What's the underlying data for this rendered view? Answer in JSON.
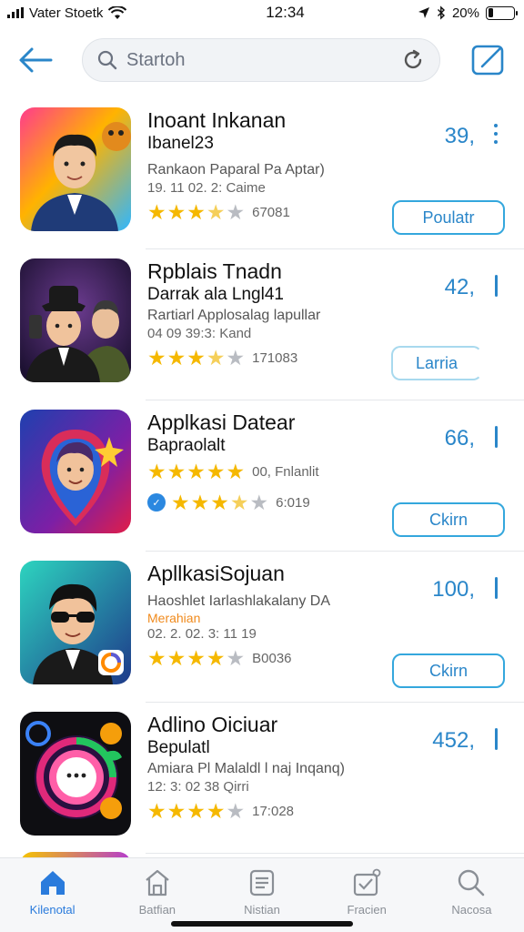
{
  "status_bar": {
    "carrier": "Vater Stoetk",
    "time": "12:34",
    "battery": "20%",
    "battery_fraction": 0.2
  },
  "header": {
    "search_placeholder": "Startoh",
    "back_icon": "arrow-left-icon",
    "refresh_icon": "refresh-icon",
    "compose_icon": "compose-icon"
  },
  "apps": [
    {
      "title": "Inoant Inkanan",
      "subtitle": "Ibanel23",
      "description": "Rankaon Paparal Pa Aptar)",
      "meta": "19. 11 02. 2: Caime",
      "rating": 3.5,
      "rating_count": "67081",
      "price": "39,",
      "action": "Poulatr"
    },
    {
      "title": "Rpblais Tnadn",
      "subtitle": "Darrak ala Lngl41",
      "description": "Rartiarl Applosalag lapullar",
      "meta": "04 09 39:3: Kand",
      "rating": 3.5,
      "rating_count": "171083",
      "price": "42,",
      "action": "Larria"
    },
    {
      "title": "Applkasi Datear",
      "subtitle": "Bapraolalt",
      "description": "",
      "meta": "",
      "rating": 5,
      "rating_text": "00, Fnlanlit",
      "rating2": 3.5,
      "rating_count": "6:019",
      "price": "66,",
      "action": "Ckirn"
    },
    {
      "title": "ApllkasiSojuan",
      "subtitle": "",
      "description": "Haoshlet Iarlashlakalany DA",
      "tag": "Merahian",
      "meta": "02. 2. 02. 3: 11 19",
      "rating": 4,
      "rating_count": "B0036",
      "price": "100,",
      "action": "Ckirn"
    },
    {
      "title": "Adlino Oiciuar",
      "subtitle": "Bepulatl",
      "description": "Amiara Pl Malaldl l naj Inqanq)",
      "meta": "12: 3: 02 38 Qirri",
      "rating": 4,
      "rating_count": "17:028",
      "price": "452,"
    }
  ],
  "tab_bar": [
    {
      "label": "Kilenotal",
      "icon": "home-icon",
      "active": true
    },
    {
      "label": "Batfian",
      "icon": "store-icon",
      "active": false
    },
    {
      "label": "Nistian",
      "icon": "list-icon",
      "active": false
    },
    {
      "label": "Fracien",
      "icon": "inbox-icon",
      "active": false
    },
    {
      "label": "Nacosa",
      "icon": "search-icon",
      "active": false
    }
  ],
  "colors": {
    "accent": "#2a86c9",
    "button_border": "#34a7dd",
    "star": "#f5b800"
  }
}
